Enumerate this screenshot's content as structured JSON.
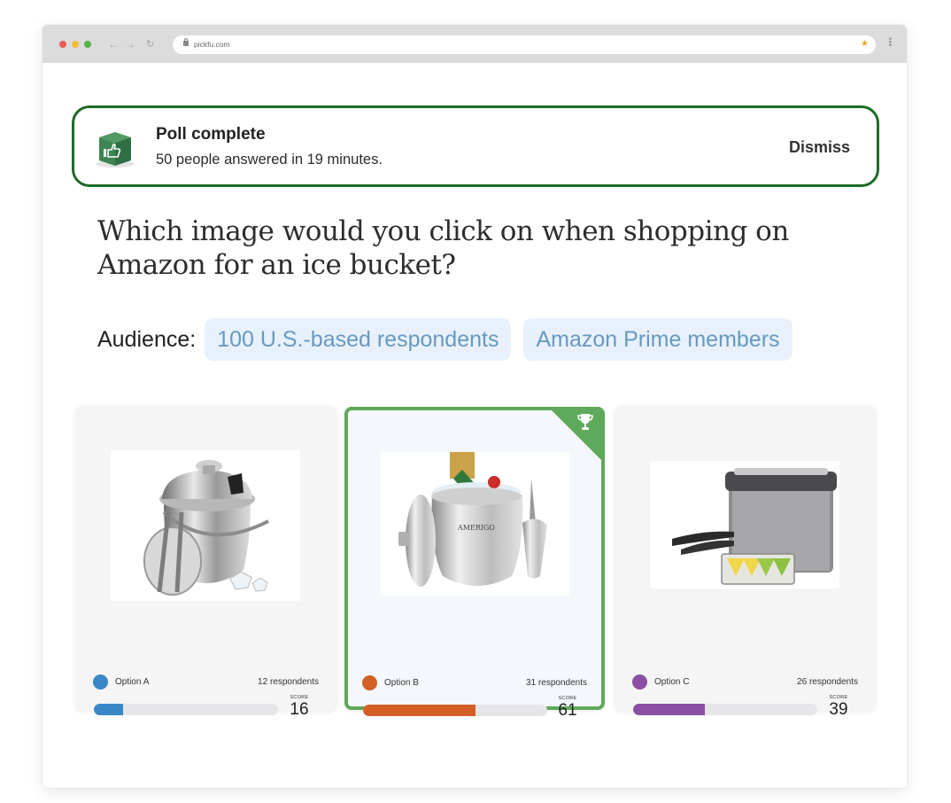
{
  "browser": {
    "url": "pickfu.com",
    "back_icon": "←",
    "forward_icon": "→",
    "reload_icon": "↻",
    "star_icon": "★",
    "menu_icon": "⋮"
  },
  "banner": {
    "title": "Poll complete",
    "subtitle": "50 people answered in 19 minutes.",
    "dismiss_label": "Dismiss",
    "icon": "thumbs-up-cube-icon",
    "border_color": "#1d6b26"
  },
  "question": "Which image would you click on when shopping on Amazon for an ice bucket?",
  "audience": {
    "label": "Audience:",
    "chips": [
      "100 U.S.-based respondents",
      "Amazon Prime members"
    ]
  },
  "options": [
    {
      "label": "Option A",
      "respondents": "12 respondents",
      "score_label": "SCORE",
      "score": "16",
      "score_value": 16,
      "color": "#3a87c8",
      "image_desc": "Stainless steel ice bucket with lid, tongs and strainer",
      "winner": false
    },
    {
      "label": "Option B",
      "respondents": "31 respondents",
      "score_label": "SCORE",
      "score": "61",
      "score_value": 61,
      "color": "#d35f27",
      "image_desc": "Amerigo stainless steel ice bucket with champagne, ice and scoop",
      "winner": true
    },
    {
      "label": "Option C",
      "respondents": "26 respondents",
      "score_label": "SCORE",
      "score": "39",
      "score_value": 39,
      "color": "#8b4fa3",
      "image_desc": "Square translucent ice bucket with tongs and citrus tray",
      "winner": false
    }
  ],
  "winner_icon": "trophy-icon",
  "winner_color": "#5ea95a"
}
